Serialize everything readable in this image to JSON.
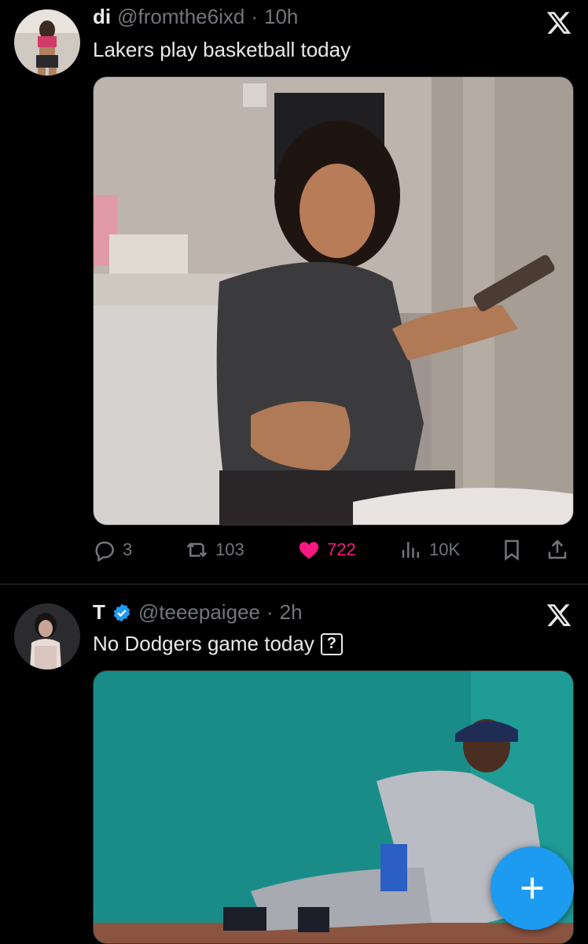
{
  "tweets": [
    {
      "display_name": "di",
      "handle": "@fromthe6ixd",
      "separator": "·",
      "time": "10h",
      "text": "Lakers play basketball today",
      "stats": {
        "replies": "3",
        "reposts": "103",
        "likes": "722",
        "views": "10K"
      }
    },
    {
      "display_name": "T",
      "handle": "@teeepaigee",
      "separator": "·",
      "time": "2h",
      "text": "No Dodgers game today",
      "emoji_box": "?"
    }
  ],
  "colors": {
    "accent": "#1d9bf0",
    "like": "#f91880",
    "muted": "#71767b",
    "background": "#000000"
  },
  "icons": [
    "x-logo-icon",
    "reply-icon",
    "repost-icon",
    "heart-icon",
    "views-icon",
    "bookmark-icon",
    "share-icon",
    "verified-badge-icon",
    "compose-plus-icon"
  ]
}
